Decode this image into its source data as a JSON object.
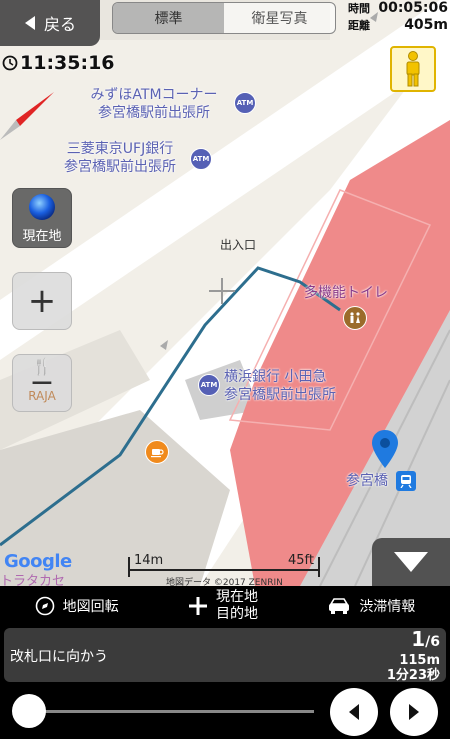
{
  "header": {
    "back_label": "戻る",
    "tabs": [
      {
        "label": "標準",
        "active": true
      },
      {
        "label": "衛星写真",
        "active": false
      }
    ],
    "time_label": "時間",
    "time_value": "00:05:06",
    "distance_label": "距離",
    "distance_value": "405m"
  },
  "clock": "11:35:16",
  "map": {
    "labels": {
      "mizuho_1": "みずほATMコーナー",
      "mizuho_2": "参宮橋駅前出張所",
      "ufj_1": "三菱東京UFJ銀行",
      "ufj_2": "参宮橋駅前出張所",
      "entrance": "出入口",
      "toilet": "多機能トイレ",
      "yokohama_1": "横浜銀行 小田急",
      "yokohama_2": "参宮橋駅前出張所",
      "station": "参宮橋",
      "poi_partial": "トラタカセ",
      "atm_icon": "ATM"
    },
    "google_logo": "Google",
    "scale_m": "14m",
    "scale_ft": "45ft",
    "copyright": "地図データ ©2017 ZENRIN"
  },
  "side_buttons": {
    "current_location": "現在地",
    "zoom_in": "+",
    "zoom_out": "−",
    "poi_label": "RAJA"
  },
  "toolbar": {
    "rotate": "地図回転",
    "current_1": "現在地",
    "current_2": "目的地",
    "traffic": "渋滞情報"
  },
  "navigation": {
    "instruction": "改札口に向かう",
    "step_current": "1",
    "step_total": "6",
    "step_distance": "115m",
    "step_time": "1分23秒"
  },
  "progress": 0.0,
  "colors": {
    "route": "#2d6e8e",
    "station_area": "#ef8a8a",
    "poi_text": "#5b62b3",
    "pin": "#1f7ae0"
  }
}
